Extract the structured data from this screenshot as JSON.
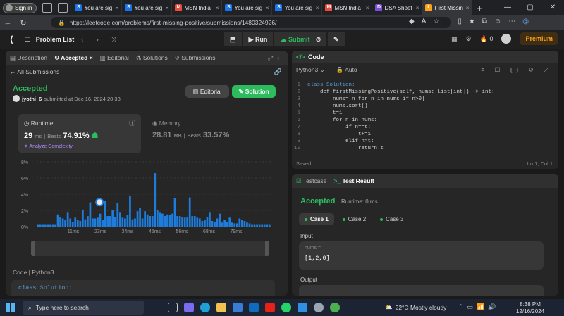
{
  "browser": {
    "signin_label": "Sign in",
    "tabs": [
      {
        "label": "You are sig",
        "icon": "S",
        "color": "#1a73e8"
      },
      {
        "label": "You are sig",
        "icon": "S",
        "color": "#1a73e8"
      },
      {
        "label": "MSN India",
        "icon": "M",
        "color": "#e94b3c"
      },
      {
        "label": "You are sig",
        "icon": "S",
        "color": "#1a73e8"
      },
      {
        "label": "You are sig",
        "icon": "S",
        "color": "#1a73e8"
      },
      {
        "label": "MSN India",
        "icon": "M",
        "color": "#e94b3c"
      },
      {
        "label": "DSA Sheet",
        "icon": "D",
        "color": "#7b4fd6"
      },
      {
        "label": "First Missin",
        "icon": "L",
        "color": "#ffa116"
      }
    ],
    "url": "https://leetcode.com/problems/first-missing-positive/submissions/1480324926/"
  },
  "leetcode": {
    "problem_list": "Problem List",
    "run_label": "Run",
    "submit_label": "Submit",
    "coins": "0",
    "premium": "Premium"
  },
  "left": {
    "tabs": [
      "Description",
      "Accepted",
      "Editorial",
      "Solutions",
      "Submissions"
    ],
    "all_submissions": "All Submissions",
    "status": "Accepted",
    "user": "jyothi_6",
    "submitted_at": "submitted at Dec 16, 2024 20:38",
    "editorial_btn": "Editorial",
    "solution_btn": "Solution",
    "runtime_label": "Runtime",
    "runtime_value": "29",
    "runtime_unit": "ms",
    "beats_label": "Beats",
    "runtime_beats": "74.91%",
    "analyze": "Analyze Complexity",
    "memory_label": "Memory",
    "memory_value": "28.81",
    "memory_unit": "MB",
    "memory_beats": "33.57%",
    "code_header": "Code | Python3",
    "code_preview": "class Solution:"
  },
  "chart_data": {
    "type": "bar",
    "yticks": [
      "8%",
      "6%",
      "4%",
      "2%",
      "0%"
    ],
    "ylim": [
      0,
      8
    ],
    "xticks": [
      "11ms",
      "23ms",
      "34ms",
      "45ms",
      "56ms",
      "68ms",
      "79ms"
    ],
    "values": [
      0.3,
      0.3,
      0.3,
      0.3,
      0.3,
      0.3,
      0.3,
      0.3,
      1.5,
      1.2,
      1.0,
      0.8,
      1.8,
      1.0,
      0.6,
      1.1,
      0.8,
      0.7,
      2.1,
      0.9,
      1.3,
      3.0,
      1.0,
      1.0,
      1.1,
      1.6,
      0.8,
      3.2,
      1.3,
      1.3,
      2.0,
      1.2,
      2.9,
      1.8,
      1.1,
      1.0,
      1.4,
      3.8,
      0.9,
      1.0,
      1.9,
      2.3,
      1.0,
      1.9,
      1.5,
      1.3,
      1.3,
      6.6,
      2.0,
      1.8,
      1.6,
      1.3,
      1.5,
      1.4,
      1.6,
      3.5,
      1.3,
      1.3,
      1.2,
      1.1,
      1.2,
      3.6,
      1.3,
      1.3,
      1.1,
      1.0,
      0.7,
      0.8,
      1.2,
      1.8,
      0.7,
      0.6,
      1.0,
      1.6,
      0.5,
      0.8,
      0.6,
      1.1,
      0.5,
      0.4,
      0.4,
      1.0,
      0.8,
      0.7,
      0.5,
      0.4,
      0.3,
      0.3,
      0.3,
      0.3,
      0.3,
      0.3,
      0.3,
      0.3
    ],
    "highlight_index": 27,
    "bar_color": "#1e7ddc"
  },
  "editor": {
    "title": "Code",
    "language": "Python3",
    "auto": "Auto",
    "lines": [
      "class Solution:",
      "    def firstMissingPositive(self, nums: List[int]) -> int:",
      "        nums=[n for n in nums if n>0]",
      "        nums.sort()",
      "        t=1",
      "        for n in nums:",
      "            if n==t:",
      "                t+=1",
      "            elif n>t:",
      "                return t"
    ],
    "saved": "Saved",
    "position": "Ln 1, Col 1"
  },
  "test": {
    "testcase_tab": "Testcase",
    "result_tab": "Test Result",
    "status": "Accepted",
    "runtime": "Runtime: 0 ms",
    "cases": [
      "Case 1",
      "Case 2",
      "Case 3"
    ],
    "input_label": "Input",
    "var_name": "nums =",
    "var_value": "[1,2,0]",
    "output_label": "Output"
  },
  "taskbar": {
    "search_placeholder": "Type here to search",
    "weather": "22°C  Mostly cloudy",
    "time": "8:38 PM",
    "date": "12/16/2024"
  }
}
